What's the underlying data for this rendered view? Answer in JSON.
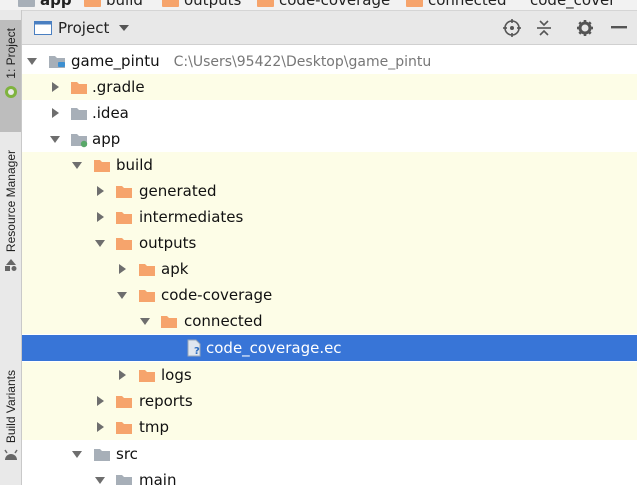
{
  "breadcrumb": {
    "items": [
      "app",
      "build",
      "outputs",
      "code-coverage",
      "connected",
      "code_cover"
    ]
  },
  "stripe": {
    "project_tab": "1: Project",
    "resource_tab": "Resource Manager",
    "build_variants_tab": "Build Variants"
  },
  "header": {
    "title": "Project"
  },
  "tree": {
    "root_label": "game_pintu",
    "root_path": "C:\\Users\\95422\\Desktop\\game_pintu",
    "gradle": ".gradle",
    "idea": ".idea",
    "app": "app",
    "build": "build",
    "generated": "generated",
    "intermediates": "intermediates",
    "outputs": "outputs",
    "apk": "apk",
    "code_coverage": "code-coverage",
    "connected": "connected",
    "ec_file": "code_coverage.ec",
    "logs": "logs",
    "reports": "reports",
    "tmp": "tmp",
    "src": "src",
    "main": "main"
  },
  "colors": {
    "selection": "#3875d7",
    "highlight_row": "#fdfde7",
    "folder_orange": "#f6a46c",
    "folder_gray": "#a7afb8"
  }
}
